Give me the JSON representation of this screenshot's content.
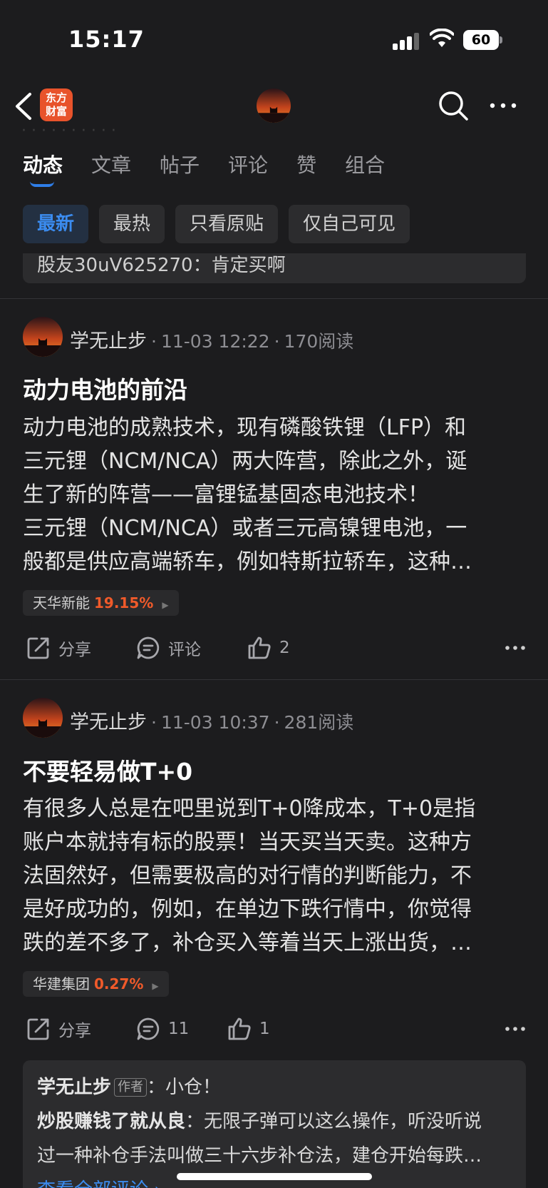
{
  "status_bar": {
    "time": "15:17",
    "battery": "60"
  },
  "header": {
    "app_logo_line1": "东方",
    "app_logo_line2": "财富"
  },
  "faded_strip": "· · · · · · · · · ·",
  "tabs": [
    "动态",
    "文章",
    "帖子",
    "评论",
    "赞",
    "组合"
  ],
  "filters": [
    "最新",
    "最热",
    "只看原贴",
    "仅自己可见"
  ],
  "prev_card_text": "股友30uV625270：肯定买啊",
  "posts": [
    {
      "author": "学无止步",
      "time": "11-03 12:22",
      "reads": "170阅读",
      "title": "动力电池的前沿",
      "lines": [
        "动力电池的成熟技术，现有磷酸铁锂（LFP）和",
        "三元锂（NCM/NCA）两大阵营，除此之外，诞",
        "生了新的阵营——富锂锰基固态电池技术！",
        "三元锂（NCM/NCA）或者三元高镍锂电池，一",
        "般都是供应高端轿车，例如特斯拉轿车，这种…"
      ],
      "stock_name": "天华新能",
      "stock_pct": "19.15%",
      "share_label": "分享",
      "comment_label": "评论",
      "like_count": "2"
    },
    {
      "author": "学无止步",
      "time": "11-03 10:37",
      "reads": "281阅读",
      "title": "不要轻易做T+0",
      "lines": [
        "有很多人总是在吧里说到T+0降成本，T+0是指",
        "账户本就持有标的股票！当天买当天卖。这种方",
        "法固然好，但需要极高的对行情的判断能力，不",
        "是好成功的，例如，在单边下跌行情中，你觉得",
        "跌的差不多了，补仓买入等着当天上涨出货，…"
      ],
      "stock_name": "华建集团",
      "stock_pct": "0.27%",
      "share_label": "分享",
      "comment_label": "11",
      "like_count": "1"
    }
  ],
  "comment_preview": {
    "reply_author": "学无止步",
    "author_badge": "作者",
    "reply_text": "：小仓！",
    "commenter": "炒股赚钱了就从良",
    "comment_line1": "：无限子弹可以这么操作，听没听说",
    "comment_line2": "过一种补仓手法叫做三十六步补仓法，建仓开始每跌…",
    "view_all": "查看全部评论 ›"
  },
  "colors": {
    "accent": "#3b8cf0",
    "up": "#f05a2a",
    "brand": "#e8532b"
  }
}
